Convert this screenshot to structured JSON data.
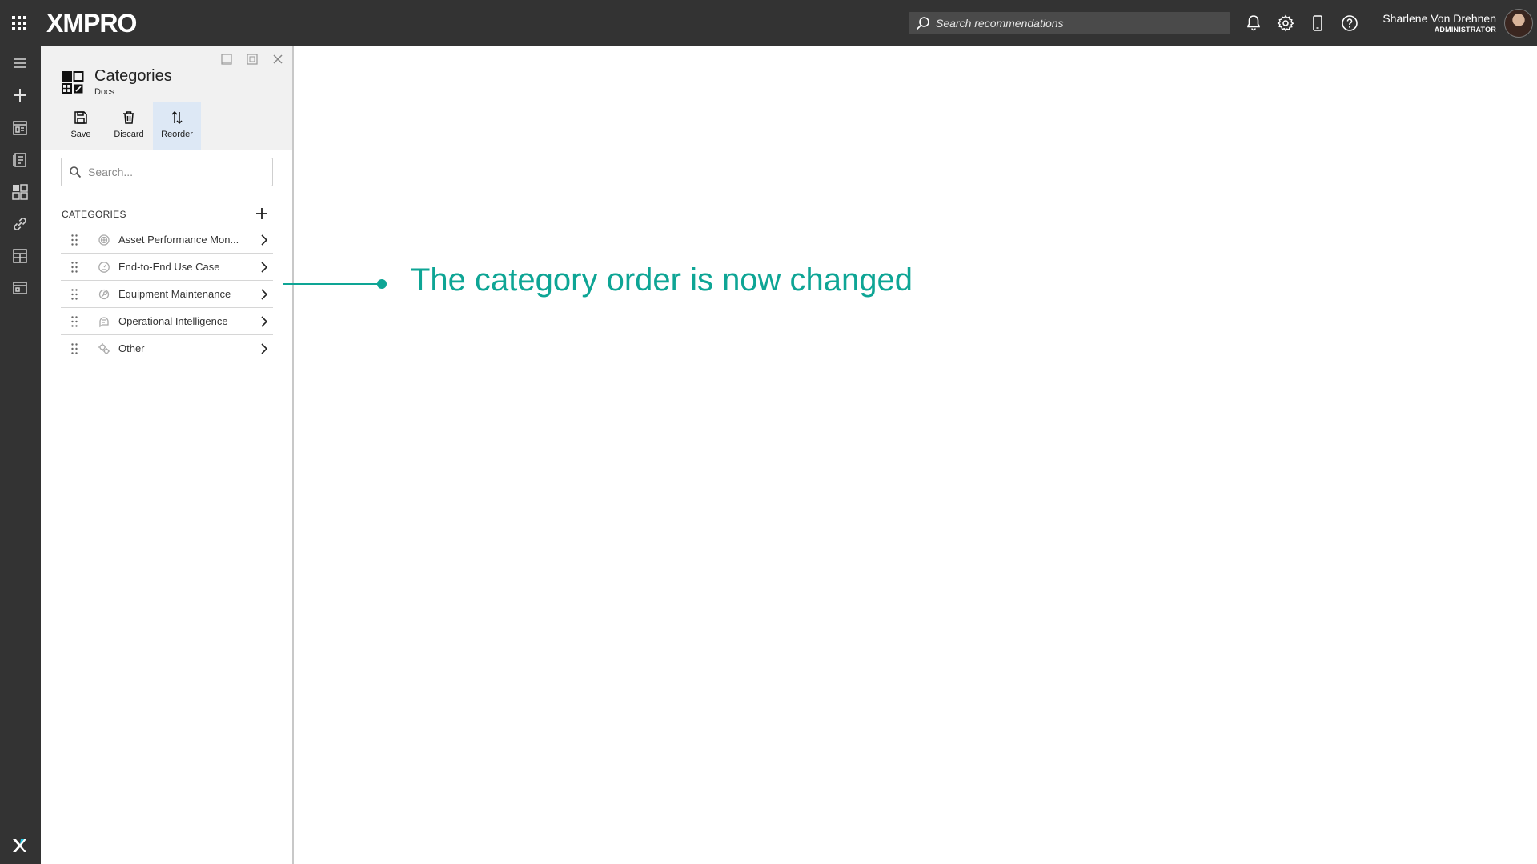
{
  "app": {
    "logo_text": "XMPRO",
    "search_placeholder": "Search recommendations",
    "user": {
      "name": "Sharlene Von Drehnen",
      "role": "ADMINISTRATOR"
    }
  },
  "topbar_icons": [
    "apps-grid-icon",
    "search-icon",
    "bell-icon",
    "gear-icon",
    "mobile-device-icon",
    "help-icon"
  ],
  "rail": {
    "items": [
      "menu-icon",
      "add-icon",
      "app-designer-icon",
      "data-stream-icon",
      "categories-icon",
      "link-icon",
      "calculator-icon",
      "recommendations-icon"
    ]
  },
  "panel": {
    "title": "Categories",
    "subtitle": "Docs",
    "toolbar": {
      "save_label": "Save",
      "discard_label": "Discard",
      "reorder_label": "Reorder"
    },
    "search_placeholder": "Search...",
    "section_label": "CATEGORIES",
    "categories": [
      {
        "label": "Asset Performance Monitoring",
        "display": "Asset Performance Mon...",
        "icon": "gauge-icon"
      },
      {
        "label": "End-to-End Use Case",
        "icon": "dashboard-icon"
      },
      {
        "label": "Equipment Maintenance",
        "icon": "wrench-icon"
      },
      {
        "label": "Operational Intelligence",
        "icon": "brain-icon"
      },
      {
        "label": "Other",
        "icon": "cog-cluster-icon"
      }
    ]
  },
  "annotation": {
    "text": "The category order is now changed"
  },
  "colors": {
    "accent": "#0ea595",
    "chrome": "#333333",
    "active_button": "#dde8f5"
  }
}
